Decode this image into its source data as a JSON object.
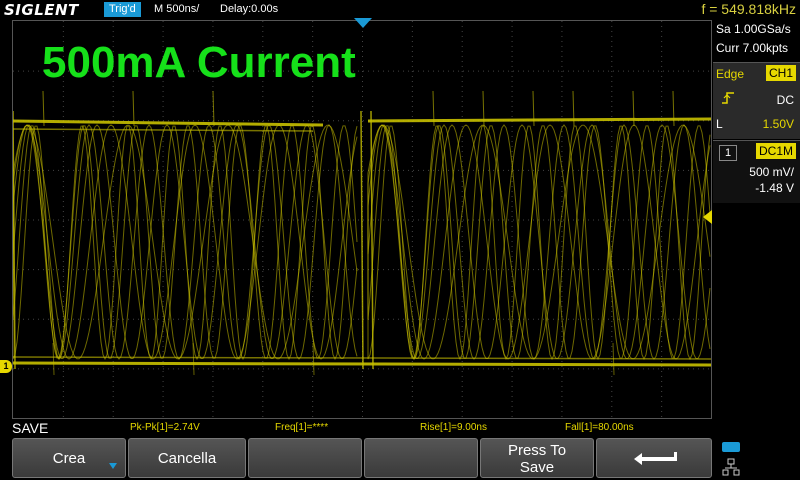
{
  "header": {
    "brand": "SIGLENT",
    "trigger_status": "Trig'd",
    "timebase": "M 500ns/",
    "delay": "Delay:0.00s",
    "frequency": "f = 549.818kHz"
  },
  "overlay_title": "500mA Current",
  "right_panel": {
    "sample_rate": "Sa 1.00GSa/s",
    "memory_depth": "Curr 7.00kpts",
    "trigger": {
      "type": "Edge",
      "source": "CH1",
      "coupling": "DC",
      "level_label": "L",
      "level": "1.50V"
    },
    "channel": {
      "number": "1",
      "coupling": "DC1M",
      "scale": "500 mV/",
      "offset": "-1.48 V"
    }
  },
  "channel_marker": "1",
  "measurements": {
    "pkpk": "Pk-Pk[1]=2.74V",
    "freq": "Freq[1]=****",
    "rise": "Rise[1]=9.00ns",
    "fall": "Fall[1]=80.00ns"
  },
  "menu_label": "SAVE",
  "softkeys": {
    "create": "Crea",
    "cancel": "Cancella",
    "press_to": "Press To",
    "save": "Save"
  },
  "colors": {
    "trace": "#c8c000",
    "accent": "#1a9ad6",
    "title": "#16e01a",
    "channel": "#e6d800"
  }
}
